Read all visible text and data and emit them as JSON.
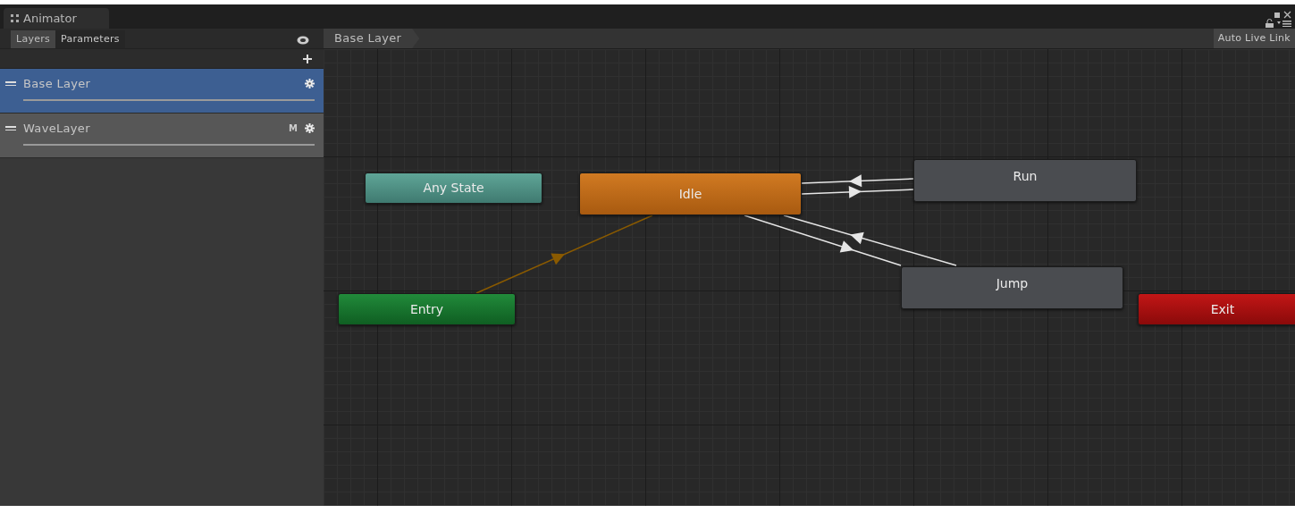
{
  "window": {
    "title": "Animator"
  },
  "panel_tabs": [
    {
      "label": "Layers",
      "selected": true
    },
    {
      "label": "Parameters",
      "selected": false
    }
  ],
  "layers": [
    {
      "name": "Base Layer",
      "selected": true
    },
    {
      "name": "WaveLayer",
      "selected": false,
      "badge": "M"
    }
  ],
  "breadcrumb": "Base Layer",
  "auto_live_link": {
    "label": "Auto Live Link"
  },
  "states": [
    {
      "name": "Any State",
      "kind": "any"
    },
    {
      "name": "Idle",
      "kind": "default"
    },
    {
      "name": "Run",
      "kind": "normal"
    },
    {
      "name": "Jump",
      "kind": "normal"
    },
    {
      "name": "Entry",
      "kind": "entry"
    },
    {
      "name": "Exit",
      "kind": "exit"
    }
  ]
}
